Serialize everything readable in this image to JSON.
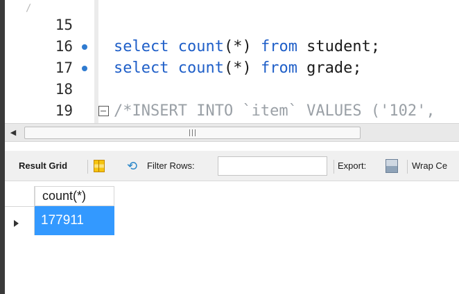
{
  "editor": {
    "lines": [
      {
        "number": "15",
        "bullet": false,
        "fold": false,
        "segments": []
      },
      {
        "number": "16",
        "bullet": true,
        "fold": false,
        "segments": [
          {
            "t": "select",
            "c": "kw"
          },
          {
            "t": " ",
            "c": "txt"
          },
          {
            "t": "count",
            "c": "kw"
          },
          {
            "t": "(*) ",
            "c": "txt"
          },
          {
            "t": "from",
            "c": "kw"
          },
          {
            "t": " student;",
            "c": "txt"
          }
        ]
      },
      {
        "number": "17",
        "bullet": true,
        "fold": false,
        "segments": [
          {
            "t": "select",
            "c": "kw"
          },
          {
            "t": " ",
            "c": "txt"
          },
          {
            "t": "count",
            "c": "kw"
          },
          {
            "t": "(*) ",
            "c": "txt"
          },
          {
            "t": "from",
            "c": "kw"
          },
          {
            "t": " grade;",
            "c": "txt"
          }
        ]
      },
      {
        "number": "18",
        "bullet": false,
        "fold": false,
        "segments": []
      },
      {
        "number": "19",
        "bullet": false,
        "fold": true,
        "segments": [
          {
            "t": "/*INSERT INTO `item` VALUES ('102',",
            "c": "cmt"
          }
        ]
      }
    ],
    "top_mark": "/"
  },
  "scrollbar": {
    "left_arrow": "◀",
    "grip": "III"
  },
  "toolbar": {
    "result_grid": "Result Grid",
    "filter_rows": "Filter Rows:",
    "filter_value": "",
    "export": "Export:",
    "wrap": "Wrap Ce"
  },
  "grid": {
    "column": "count(*)",
    "rows": [
      {
        "value": "177911",
        "selected": true
      }
    ]
  },
  "colors": {
    "keyword": "#1f5fc8",
    "comment": "#9aa0a6",
    "selection": "#3399ff",
    "bullet": "#2f7bd0"
  }
}
